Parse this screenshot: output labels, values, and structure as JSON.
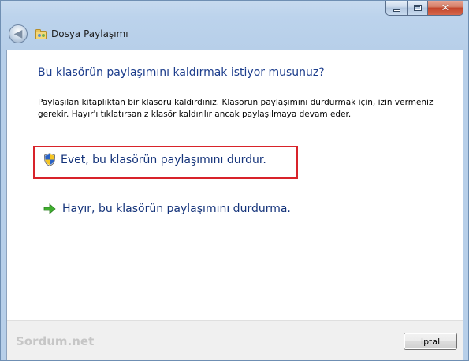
{
  "window": {
    "title": "Dosya Paylaşımı"
  },
  "caption_buttons": {
    "minimize": "minimize-icon",
    "maximize": "maximize-icon",
    "close": "close-icon"
  },
  "nav": {
    "back_icon": "back-arrow-icon",
    "app_icon": "sharing-icon"
  },
  "dialog": {
    "heading": "Bu klasörün paylaşımını kaldırmak istiyor musunuz?",
    "description": "Paylaşılan kitaplıktan bir klasörü kaldırdınız. Klasörün paylaşımını durdurmak için, izin vermeniz gerekir. Hayır'ı tıklatırsanız klasör kaldırılır ancak paylaşılmaya devam eder.",
    "option_yes": "Evet, bu klasörün paylaşımını durdur.",
    "option_no": "Hayır, bu klasörün paylaşımını durdurma."
  },
  "footer": {
    "brand": "Sordum.net",
    "cancel_label": "İptal"
  },
  "colors": {
    "heading": "#1c3d8c",
    "option_link": "#14337a",
    "highlight_border": "#d8232a"
  }
}
